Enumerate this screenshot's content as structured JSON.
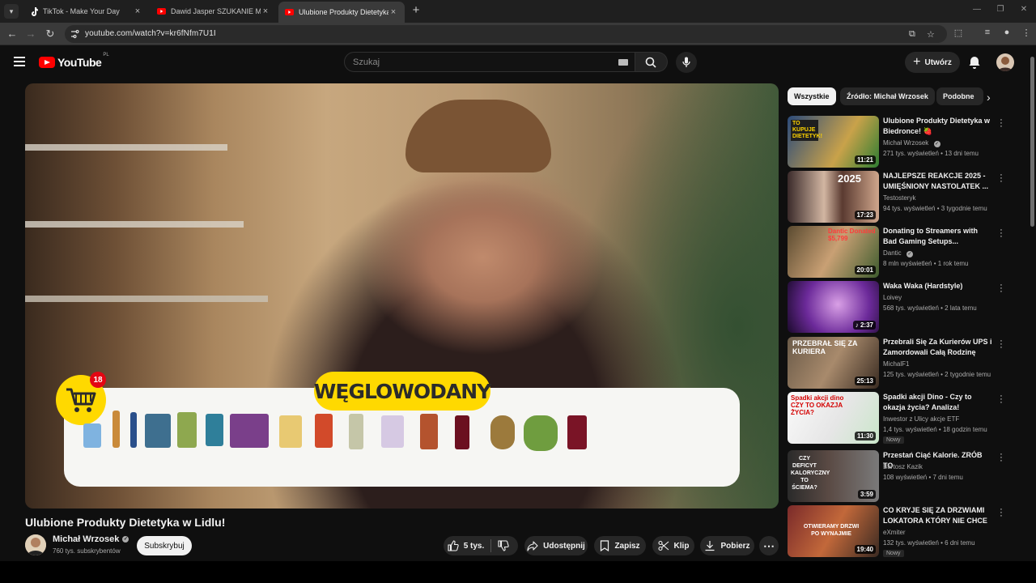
{
  "browser": {
    "tabs": [
      {
        "label": "TikTok - Make Your Day",
        "icon": "tiktok-icon",
        "active": false
      },
      {
        "label": "Dawid Jasper SZUKANIE MIŁOŚ",
        "icon": "youtube-icon",
        "active": false
      },
      {
        "label": "Ulubione Produkty Dietetyka w",
        "icon": "youtube-icon",
        "active": true
      }
    ],
    "url": "youtube.com/watch?v=kr6fNfm7U1I"
  },
  "youtube": {
    "logo_text": "YouTube",
    "country": "PL",
    "search_placeholder": "Szukaj",
    "create_label": "Utwórz"
  },
  "video": {
    "overlay_label": "WĘGLOWODANY",
    "cart_count": "18",
    "title": "Ulubione Produkty Dietetyka w Lidlu!",
    "channel": "Michał Wrzosek",
    "subscribers": "760 tys. subskrybentów",
    "subscribe_label": "Subskrybuj",
    "likes": "5 tys.",
    "share_label": "Udostępnij",
    "save_label": "Zapisz",
    "clip_label": "Klip",
    "download_label": "Pobierz"
  },
  "chips": [
    "Wszystkie",
    "Źródło: Michał Wrzosek",
    "Podobne"
  ],
  "recommendations": [
    {
      "title": "Ulubione Produkty Dietetyka w Biedronce! 🍓",
      "channel": "Michał Wrzosek",
      "verified": true,
      "meta": "271 tys. wyświetleń • 13 dni temu",
      "duration": "11:21",
      "badge": ""
    },
    {
      "title": "NAJLEPSZE REAKCJE 2025 - UMIĘŚNIONY NASTOLATEK ...",
      "channel": "Testosteryk",
      "verified": false,
      "meta": "94 tys. wyświetleń • 3 tygodnie temu",
      "duration": "17:23",
      "badge": ""
    },
    {
      "title": "Donating to Streamers with Bad Gaming Setups...",
      "channel": "Dantic",
      "verified": true,
      "meta": "8 mln wyświetleń • 1 rok temu",
      "duration": "20:01",
      "badge": ""
    },
    {
      "title": "Waka Waka (Hardstyle)",
      "channel": "Loivey",
      "verified": false,
      "meta": "568 tys. wyświetleń • 2 lata temu",
      "duration": "2:37",
      "badge": ""
    },
    {
      "title": "Przebrali Się Za Kurierów UPS i Zamordowali Całą Rodzinę",
      "channel": "MichalF1",
      "verified": false,
      "meta": "125 tys. wyświetleń • 2 tygodnie temu",
      "duration": "25:13",
      "badge": ""
    },
    {
      "title": "Spadki akcji Dino - Czy to okazja życia? Analiza!",
      "channel": "Inwestor z Ulicy akcje ETF",
      "verified": false,
      "meta": "1,4 tys. wyświetleń • 18 godzin temu",
      "duration": "11:30",
      "badge": "Nowy"
    },
    {
      "title": "Przestań Ciąć Kalorie. ZRÓB TO",
      "channel": "Bartosz Kazik",
      "verified": false,
      "meta": "108 wyświetleń • 7 dni temu",
      "duration": "3:59",
      "badge": ""
    },
    {
      "title": "CO KRYJE SIĘ ZA DRZWIAMI LOKATORA KTÓRY NIE CHCE ...",
      "channel": "eXmiter",
      "verified": false,
      "meta": "132 tys. wyświetleń • 6 dni temu",
      "duration": "19:40",
      "badge": "Nowy"
    }
  ],
  "thumb_texts": [
    "TO KUPUJE DIETETYK!",
    "2025",
    "Dantic Donated $5,799",
    "",
    "PRZEBRAŁ SIĘ ZA KURIERA",
    "Spadki akcji dino CZY TO OKAZJA ŻYCIA?",
    "CZY DEFICYT KALORYCZNY TO ŚCIEMA?",
    "OTWIERAMY DRZWI PO WYNAJMIE"
  ],
  "colors": {
    "yt_red": "#ff0000",
    "overlay_yellow": "#ffd900",
    "badge_red": "#e30613",
    "bg": "#0f0f0f"
  }
}
